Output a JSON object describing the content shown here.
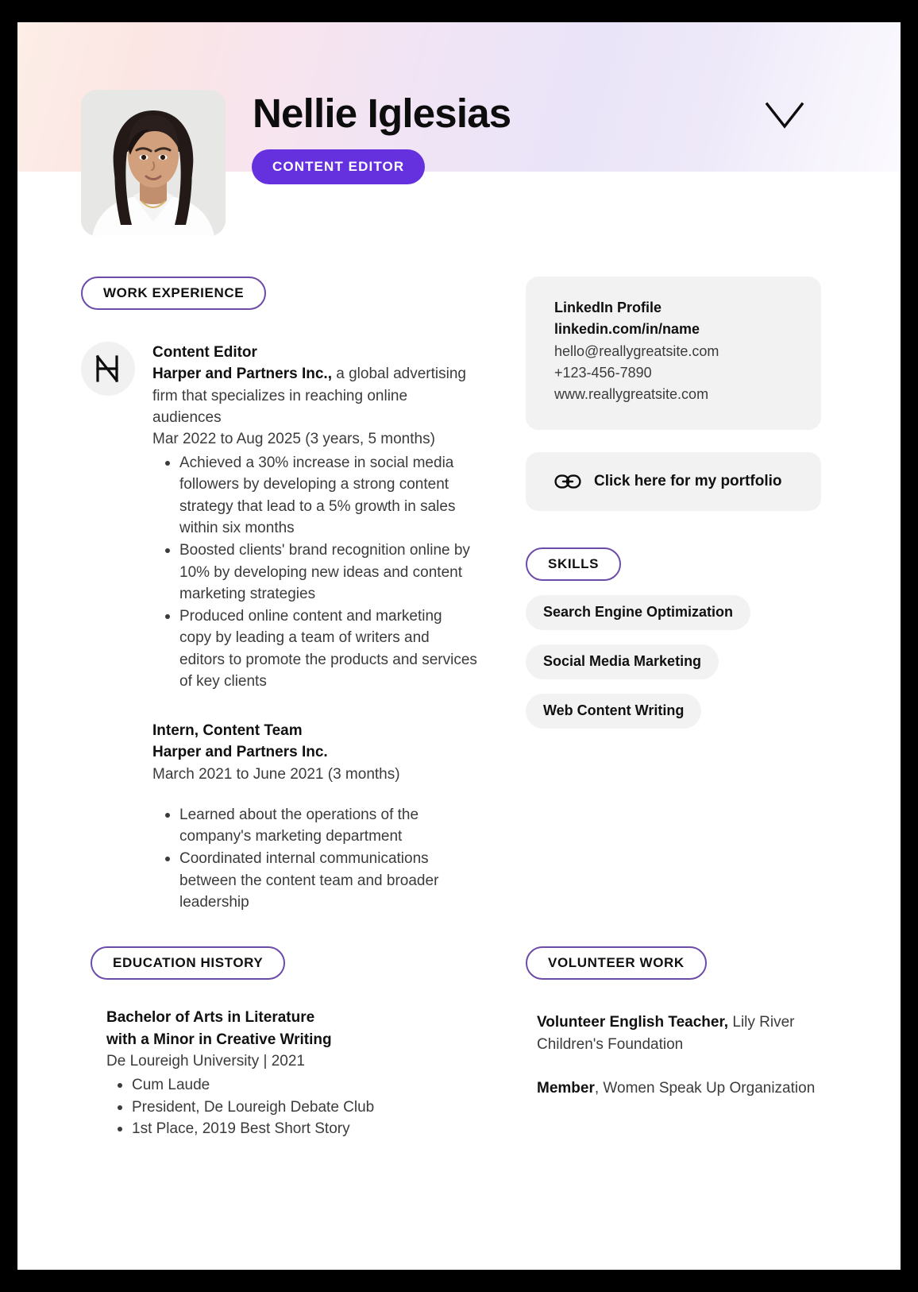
{
  "theme": {
    "accent_purple": "#6530dd",
    "pill_border_purple": "#6d4ba8",
    "card_gray": "#f2f2f2",
    "text_dark": "#101010",
    "text_body": "#3b3b3b",
    "page_background": "#ffffff",
    "canvas_background": "#000000"
  },
  "header": {
    "name": "Nellie Iglesias",
    "role_badge": "CONTENT EDITOR",
    "chevron_icon": "chevron-down-icon",
    "avatar_icon": "profile-photo"
  },
  "work": {
    "heading": "WORK EXPERIENCE",
    "jobs": [
      {
        "logo_icon": "harper-monogram-icon",
        "title": "Content Editor",
        "company": "Harper and Partners Inc.,",
        "company_description": " a global advertising firm that specializes in reaching online audiences",
        "dates": "Mar 2022 to Aug 2025 (3 years, 5 months)",
        "bullets": [
          "Achieved a 30% increase in social media followers by developing a strong content strategy that lead to a 5% growth in sales within six months",
          "Boosted clients' brand recognition online by 10% by developing new ideas and content marketing strategies",
          "Produced online content and marketing copy by leading a team of writers and editors to promote the products and services of key clients"
        ]
      },
      {
        "title": "Intern, Content Team",
        "company": "Harper and Partners Inc.",
        "dates": "March 2021 to June 2021 (3 months)",
        "bullets": [
          "Learned about the operations of the company's marketing department",
          "Coordinated internal communications between the content team and broader leadership"
        ]
      }
    ]
  },
  "contact": {
    "linkedin_label": "LinkedIn Profile",
    "linkedin_url": "linkedin.com/in/name",
    "email": "hello@reallygreatsite.com",
    "phone": "+123-456-7890",
    "website": "www.reallygreatsite.com"
  },
  "portfolio": {
    "icon": "link-icon",
    "label": "Click here for my portfolio"
  },
  "skills": {
    "heading": "SKILLS",
    "items": [
      "Search Engine Optimization",
      "Social Media Marketing",
      "Web Content Writing"
    ]
  },
  "education": {
    "heading": "EDUCATION HISTORY",
    "degree_line1": "Bachelor of Arts in Literature",
    "degree_line2": "with a Minor in Creative Writing",
    "school": "De Loureigh University | 2021",
    "bullets": [
      "Cum Laude",
      "President, De Loureigh Debate Club",
      "1st Place, 2019 Best Short Story"
    ]
  },
  "volunteer": {
    "heading": "VOLUNTEER WORK",
    "entries": [
      {
        "role": "Volunteer English Teacher,",
        "org": " Lily River Children's Foundation"
      },
      {
        "role": "Member",
        "org": ", Women Speak Up Organization"
      }
    ]
  }
}
